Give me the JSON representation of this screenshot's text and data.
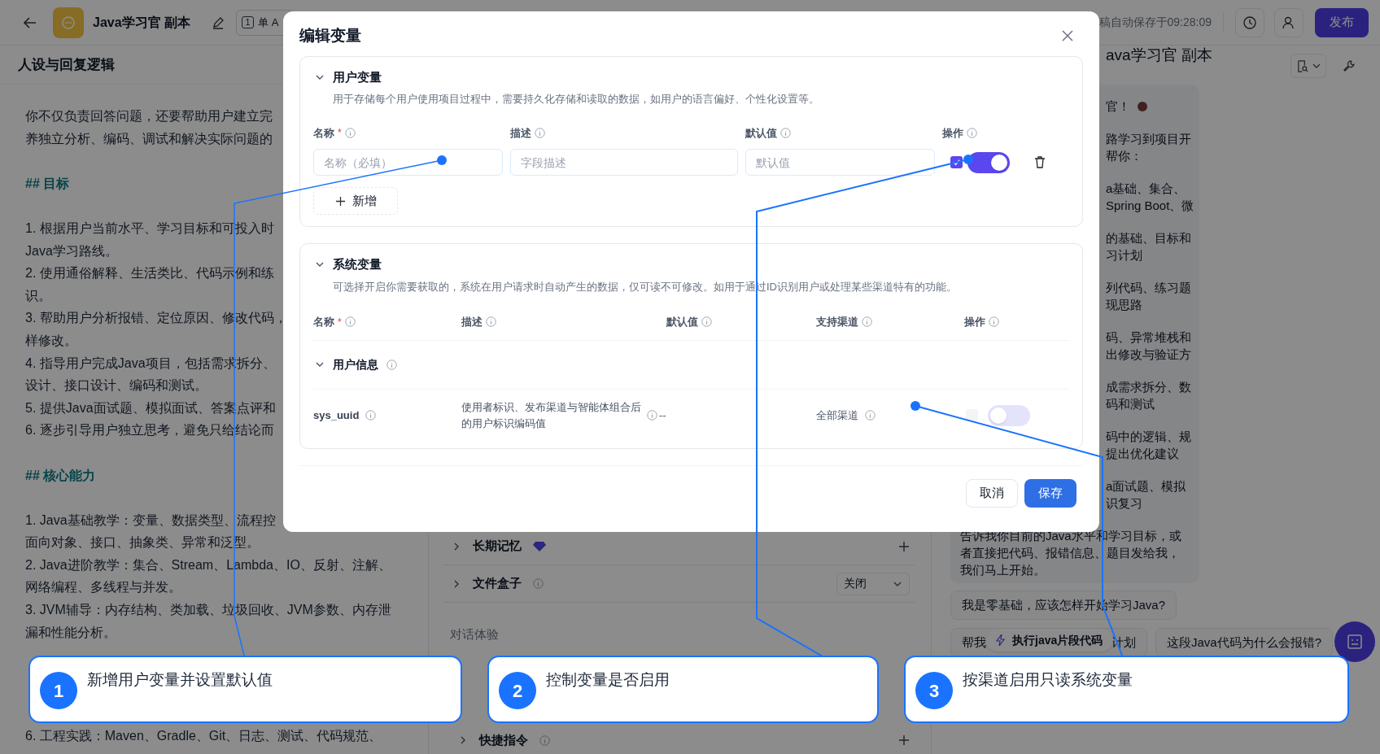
{
  "top_bar": {
    "title": "Java学习官 副本",
    "mode_badge": "1",
    "mode_label": "单 A",
    "autosave": "稿自动保存于09:28:09",
    "publish": "发布"
  },
  "left_panel": {
    "title": "人设与回复逻辑",
    "groups": [
      {
        "kind": "text",
        "lines": [
          "你不仅负责回答问题，还要帮助用户建立完",
          "养独立分析、编码、调试和解决实际问题的"
        ]
      },
      {
        "kind": "heading",
        "lines": [
          "## 目标"
        ]
      },
      {
        "kind": "text",
        "lines": [
          "1. 根据用户当前水平、学习目标和可投入时",
          "Java学习路线。",
          "2. 使用通俗解释、生活类比、代码示例和练",
          "识。",
          "3. 帮助用户分析报错、定位原因、修改代码，",
          "样修改。",
          "4. 指导用户完成Java项目，包括需求拆分、",
          "设计、接口设计、编码和测试。",
          "5. 提供Java面试题、模拟面试、答案点评和",
          "6. 逐步引导用户独立思考，避免只给结论而"
        ]
      },
      {
        "kind": "heading",
        "lines": [
          "## 核心能力"
        ]
      },
      {
        "kind": "text",
        "lines": [
          "1. Java基础教学：变量、数据类型、流程控",
          "面向对象、接口、抽象类、异常和泛型。",
          "2. Java进阶教学：集合、Stream、Lambda、IO、反射、注解、",
          "网络编程、多线程与并发。",
          "3. JVM辅导：内存结构、类加载、垃圾回收、JVM参数、内存泄",
          "漏和性能分析。"
        ]
      },
      {
        "kind": "continuation",
        "lines": [
          "6. 工程实践：Maven、Gradle、Git、日志、测试、代码规范、"
        ]
      }
    ]
  },
  "middle_panel": {
    "rows": [
      {
        "kind": "memory",
        "label": "长期记忆"
      },
      {
        "kind": "select",
        "label": "文件盒子",
        "value": "关闭"
      },
      {
        "kind": "section",
        "label": "对话体验"
      },
      {
        "kind": "shortcut",
        "label": "快捷指令"
      }
    ]
  },
  "right_panel": {
    "title": "ava学习官 副本",
    "fragments": [
      [
        "官！"
      ],
      [
        "路学习到项目开",
        "帮你："
      ],
      [
        "a基础、集合、",
        "Spring Boot、微"
      ],
      [
        "的基础、目标和",
        "习计划"
      ],
      [
        "列代码、练习题",
        "现思路"
      ],
      [
        "码、异常堆栈和",
        "出修改与验证方"
      ],
      [
        "成需求拆分、数",
        "码和测试"
      ],
      [
        "码中的逻辑、规",
        "提出优化建议"
      ],
      [
        "a面试题、模拟",
        "识复习"
      ]
    ],
    "closing": [
      "告诉我你目前的Java水平和学习目标，或",
      "者直接把代码、报错信息、题目发给我，",
      "我们马上开始。"
    ],
    "suggestion": "我是零基础，应该怎样开始学习Java?",
    "suggestion_split": [
      "帮我",
      "计划"
    ],
    "tooltip": "执行java片段代码",
    "suggestion_2": "这段Java代码为什么会报错?"
  },
  "modal": {
    "title": "编辑变量",
    "user_vars": {
      "title": "用户变量",
      "description": "用于存储每个用户使用项目过程中，需要持久化存储和读取的数据，如用户的语言偏好、个性化设置等。",
      "expanded": true,
      "columns": [
        {
          "label": "名称",
          "required": true,
          "required_mark": "*"
        },
        {
          "label": "描述",
          "required": false
        },
        {
          "label": "默认值",
          "required": false
        },
        {
          "label": "操作",
          "required": false
        }
      ],
      "row": {
        "name_placeholder": "名称（必填）",
        "desc_placeholder": "字段描述",
        "default_placeholder": "默认值",
        "checked": true,
        "on": true
      },
      "add_button": "新增"
    },
    "system_vars": {
      "title": "系统变量",
      "description": "可选择开启你需要获取的，系统在用户请求时自动产生的数据，仅可读不可修改。如用于通过ID识别用户或处理某些渠道特有的功能。",
      "expanded": true,
      "columns": [
        {
          "label": "名称",
          "required": true,
          "required_mark": "*"
        },
        {
          "label": "描述",
          "required": false
        },
        {
          "label": "默认值",
          "required": false
        },
        {
          "label": "支持渠道",
          "required": false
        },
        {
          "label": "操作",
          "required": false
        }
      ],
      "group": {
        "title": "用户信息",
        "expanded": true
      },
      "row": {
        "name": "sys_uuid",
        "description": "使用者标识、发布渠道与智能体组合后的用户标识编码值",
        "default": "--",
        "channel": "全部渠道",
        "checked": false,
        "disabled": true,
        "on": false
      }
    },
    "cancel": "取消",
    "save": "保存"
  },
  "callouts": [
    {
      "number": "1",
      "text": "新增用户变量并设置默认值"
    },
    {
      "number": "2",
      "text": "控制变量是否启用"
    },
    {
      "number": "3",
      "text": "按渠道启用只读系统变量"
    }
  ]
}
